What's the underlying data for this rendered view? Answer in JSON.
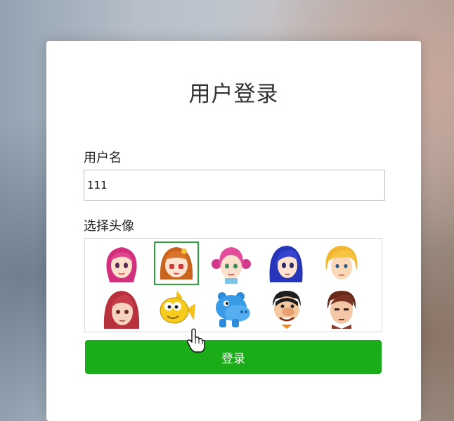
{
  "login": {
    "title": "用户登录",
    "username_label": "用户名",
    "username_value": "111",
    "avatar_label": "选择头像",
    "button_label": "登录",
    "accent_color": "#1aad19",
    "selected_avatar": 2
  },
  "avatars": [
    {
      "icon": "pink-hair-girl-avatar-icon"
    },
    {
      "icon": "brown-hair-girl-avatar-icon"
    },
    {
      "icon": "pink-pigtails-girl-avatar-icon"
    },
    {
      "icon": "blue-hair-girl-avatar-icon"
    },
    {
      "icon": "blonde-boy-avatar-icon"
    },
    {
      "icon": "red-hair-woman-avatar-icon"
    },
    {
      "icon": "yellow-fish-avatar-icon"
    },
    {
      "icon": "blue-hippo-avatar-icon"
    },
    {
      "icon": "cartoon-man-avatar-icon"
    },
    {
      "icon": "brown-hair-man-avatar-icon"
    }
  ]
}
